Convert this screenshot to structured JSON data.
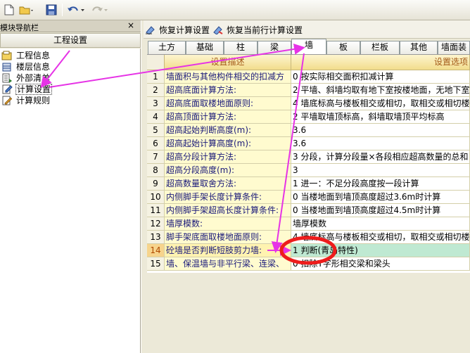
{
  "left_panel": {
    "title": "模块导航栏",
    "pin": "ᅟ",
    "close": "×",
    "header": "工程设置",
    "items": [
      {
        "label": "工程信息",
        "icon": "project-info-icon"
      },
      {
        "label": "楼层信息",
        "icon": "floor-info-icon"
      },
      {
        "label": "外部清单",
        "icon": "external-list-icon"
      },
      {
        "label": "计算设置",
        "icon": "calc-settings-icon"
      },
      {
        "label": "计算规则",
        "icon": "calc-rules-icon"
      }
    ],
    "selected_index": 3
  },
  "right_toolbar": {
    "restore_calc": "恢复计算设置",
    "restore_row": "恢复当前行计算设置"
  },
  "tabs": [
    "土方",
    "基础",
    "柱",
    "梁",
    "墙",
    "板",
    "栏板",
    "其他",
    "墙面装修"
  ],
  "active_tab": 4,
  "grid": {
    "headers": [
      "设置描述",
      "设置选项"
    ],
    "rows": [
      {
        "n": "1",
        "desc": "墙面积与其他构件相交的扣减方",
        "val": "0 按实际相交面积扣减计算"
      },
      {
        "n": "2",
        "desc": "超高底面计算方法:",
        "val": "2 平墙、斜墙均取有地下室按楼地面，无地下室"
      },
      {
        "n": "3",
        "desc": "超高底面取楼地面原则:",
        "val": "4 墙底标高与楼板相交或相切，取相交或相切楼"
      },
      {
        "n": "4",
        "desc": "超高顶面计算方法:",
        "val": "2 平墙取墙顶标高，斜墙取墙顶平均标高"
      },
      {
        "n": "5",
        "desc": "超高起始判断高度(m):",
        "val": "3.6"
      },
      {
        "n": "6",
        "desc": "超高起始计算高度(m):",
        "val": "3.6"
      },
      {
        "n": "7",
        "desc": "超高分段计算方法:",
        "val": "3 分段，计算分段量×各段相应超高数量的总和"
      },
      {
        "n": "8",
        "desc": "超高分段高度(m):",
        "val": "3"
      },
      {
        "n": "9",
        "desc": "超高数量取舍方法:",
        "val": "1 进一：不足分段高度按一段计算"
      },
      {
        "n": "10",
        "desc": "内侧脚手架长度计算条件:",
        "val": "0 当楼地面到墙顶高度超过3.6m时计算"
      },
      {
        "n": "11",
        "desc": "内侧脚手架超高长度计算条件:",
        "val": "0 当楼地面到墙顶高度超过4.5m时计算"
      },
      {
        "n": "12",
        "desc": "墙厚模数:",
        "val": "墙厚模数"
      },
      {
        "n": "13",
        "desc": "脚手架底面取楼地面原则:",
        "val": "4 墙底标高与楼板相交或相切，取相交或相切楼"
      },
      {
        "n": "14",
        "desc": "砼墙是否判断短肢剪力墙:",
        "val": "1 判断(青岛特性)"
      },
      {
        "n": "15",
        "desc": "墙、保温墙与非平行梁、连梁、",
        "val": "0 扣除T字形相交梁和梁头"
      }
    ],
    "selected_row": 13
  },
  "colors": {
    "annotation": "#e633e6",
    "highlight_circle": "#ee1c1c",
    "selected_value_bg": "#bfe9d2"
  }
}
